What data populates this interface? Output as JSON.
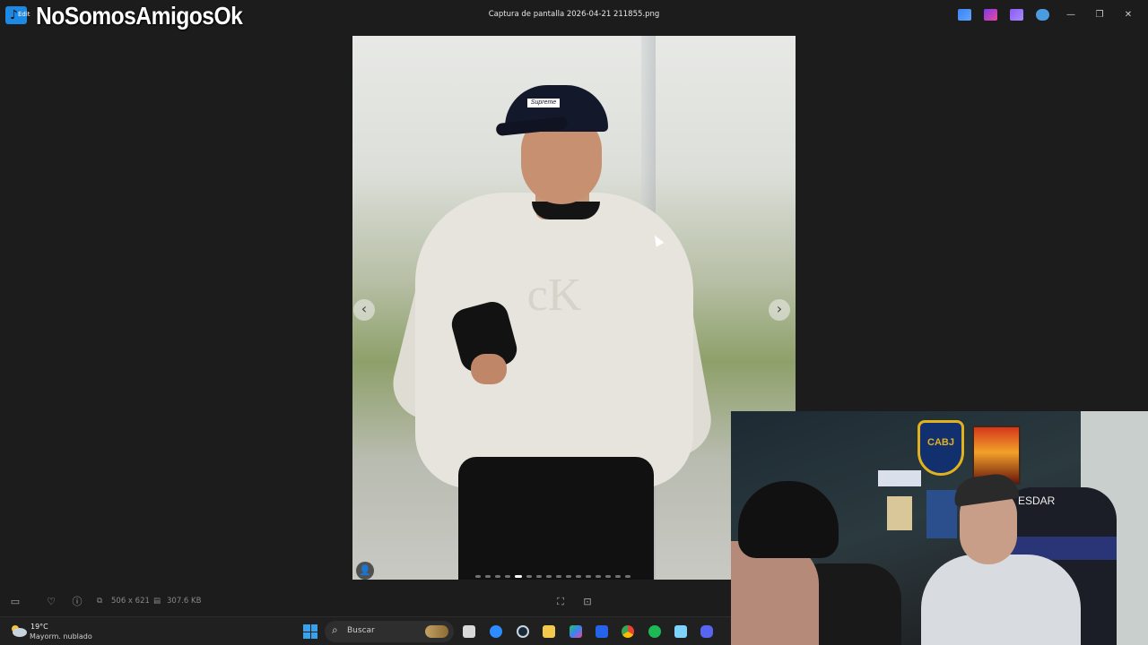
{
  "window": {
    "title": "Captura de pantalla 2026-04-21 211855.png",
    "overlay_watermark": "NoSomosAmigosOk",
    "app_icon_label": "Edit",
    "controls": {
      "minimize": "—",
      "restore": "❐",
      "close": "✕"
    }
  },
  "viewer": {
    "prev_icon": "‹",
    "next_icon": "›",
    "person_icon": "👤",
    "cap_text": "Supreme",
    "sweater_logo": "cK",
    "page_dots_count": 16,
    "active_dot_index": 4
  },
  "status": {
    "dimensions": "506 x 621",
    "file_size": "307.6 KB"
  },
  "taskbar": {
    "weather_temp": "19°C",
    "weather_desc": "Mayorm. nublado",
    "search_placeholder": "Buscar"
  },
  "webcam": {
    "crest_text": "CABJ",
    "chair_text": "ESDAR"
  },
  "colors": {
    "background": "#1c1c1c",
    "taskbar": "#202020",
    "accent": "#3aa0ea"
  }
}
